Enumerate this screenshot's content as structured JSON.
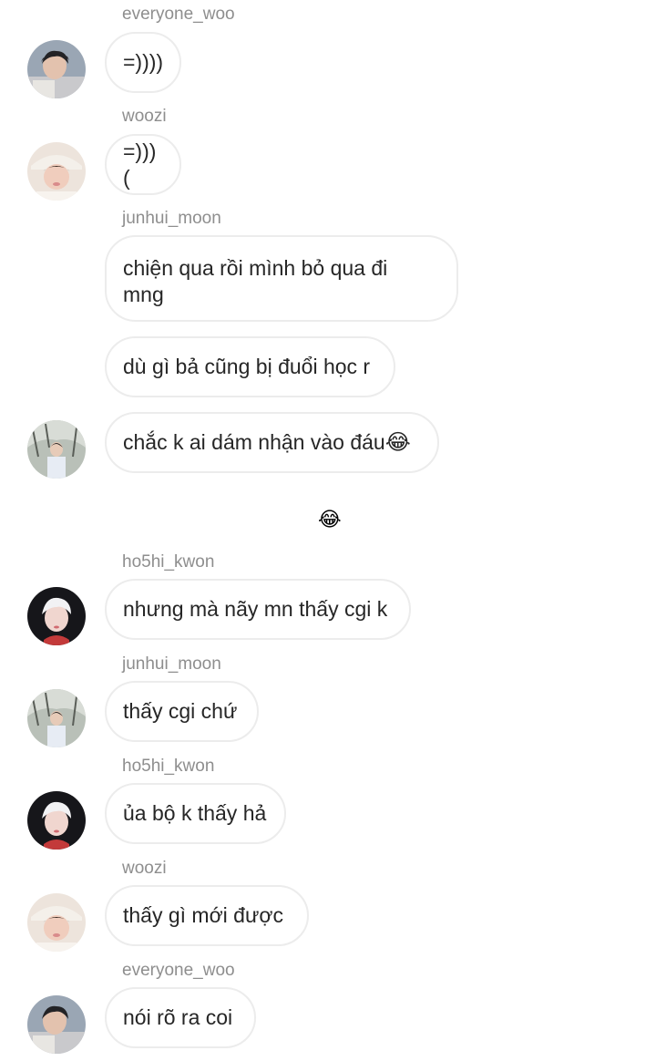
{
  "messages": [
    {
      "username": "everyone_woo",
      "text": "=))))",
      "avatar": "avatar-everyone-woo"
    },
    {
      "username": "woozi",
      "text": "=)))(",
      "avatar": "avatar-woozi"
    },
    {
      "username": "junhui_moon",
      "text": "chiện qua rồi mình bỏ qua đi mng"
    },
    {
      "text": "dù gì bả cũng bị đuổi học r"
    },
    {
      "text": "chắc k ai dám nhận vào đáu",
      "avatar": "avatar-junhui-moon"
    },
    {
      "reaction_emoji": "😂"
    },
    {
      "username": "ho5hi_kwon",
      "text": "nhưng mà nãy mn thấy cgi k",
      "avatar": "avatar-ho5hi-kwon"
    },
    {
      "username": "junhui_moon",
      "text": "thấy cgi chứ",
      "avatar": "avatar-junhui-moon"
    },
    {
      "username": "ho5hi_kwon",
      "text": "ủa bộ k thấy hả",
      "avatar": "avatar-ho5hi-kwon"
    },
    {
      "username": "woozi",
      "text": "thấy gì mới được",
      "avatar": "avatar-woozi"
    },
    {
      "username": "everyone_woo",
      "text": "nói rõ ra coi",
      "avatar": "avatar-everyone-woo"
    }
  ],
  "inline_emoji": "😂",
  "colors": {
    "username": "#8e8e8e",
    "bubble_border": "#ececec",
    "text": "#262626",
    "background": "#ffffff"
  }
}
